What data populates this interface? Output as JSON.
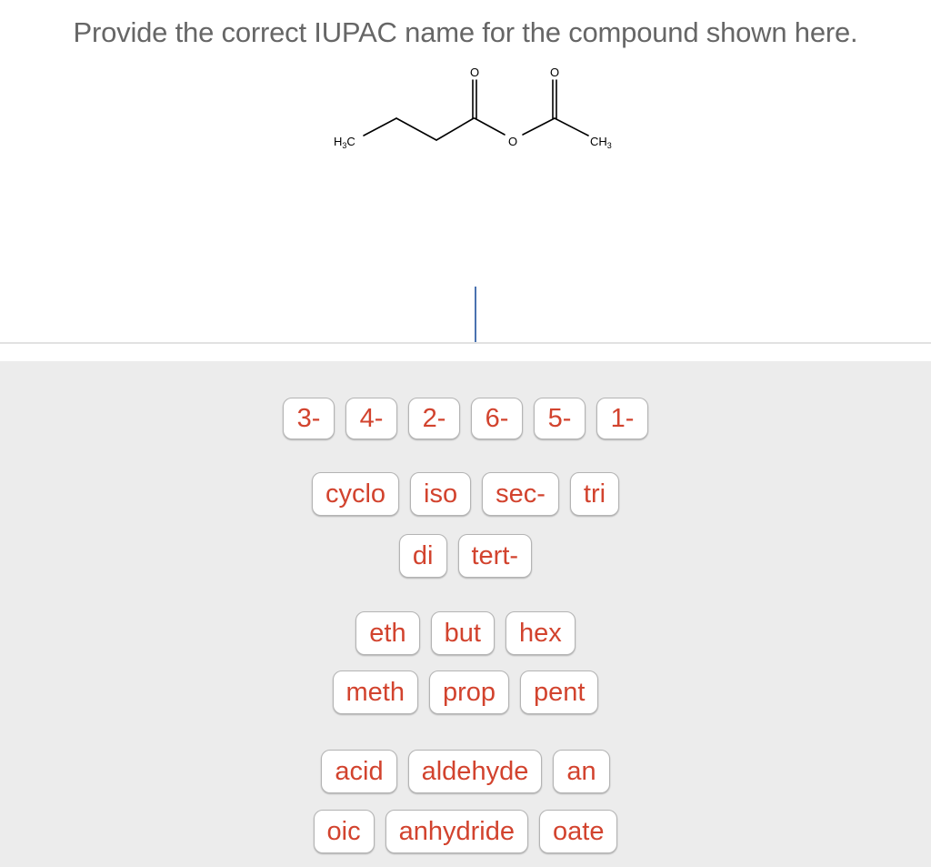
{
  "question": {
    "text": "Provide the correct IUPAC name for the compound shown here."
  },
  "structure": {
    "description": "butanoic ethanoic anhydride (skeletal formula)",
    "labels": {
      "left_methyl": "H3C",
      "right_methyl": "CH3",
      "carbonyl_o_left": "O",
      "carbonyl_o_right": "O",
      "bridge_o": "O"
    }
  },
  "answer": {
    "value": ""
  },
  "palette": {
    "locants": [
      "3-",
      "4-",
      "2-",
      "6-",
      "5-",
      "1-"
    ],
    "prefixes": [
      "cyclo",
      "iso",
      "sec-",
      "tri"
    ],
    "prefixes2": [
      "di",
      "tert-"
    ],
    "roots1": [
      "eth",
      "but",
      "hex"
    ],
    "roots2": [
      "meth",
      "prop",
      "pent"
    ],
    "suffixes1": [
      "acid",
      "aldehyde",
      "an"
    ],
    "suffixes2": [
      "oic",
      "anhydride",
      "oate"
    ]
  },
  "colors": {
    "tile_text": "#d2432e",
    "question_text": "#666666",
    "palette_bg": "#ececec",
    "cursor": "#4a72b0"
  }
}
